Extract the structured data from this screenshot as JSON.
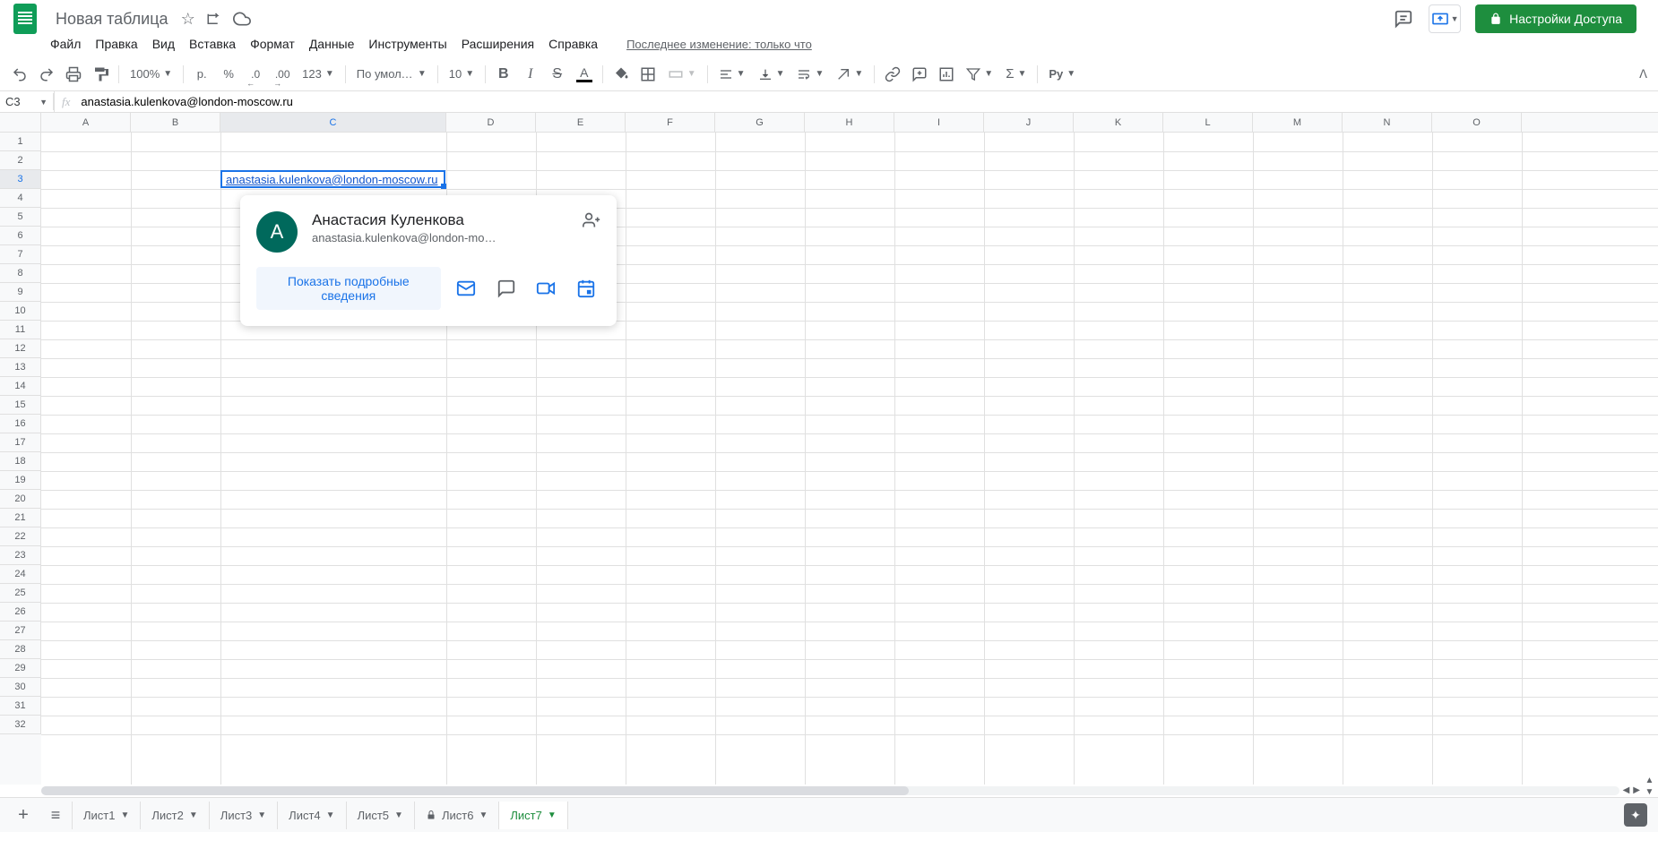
{
  "header": {
    "title": "Новая таблица",
    "last_edit": "Последнее изменение: только что",
    "share_label": "Настройки Доступа"
  },
  "menu": [
    "Файл",
    "Правка",
    "Вид",
    "Вставка",
    "Формат",
    "Данные",
    "Инструменты",
    "Расширения",
    "Справка"
  ],
  "toolbar": {
    "zoom": "100%",
    "currency": "р.",
    "percent": "%",
    "dec_dec": ".0",
    "inc_dec": ".00",
    "format": "123",
    "font": "По умолча...",
    "font_size": "10"
  },
  "formula_bar": {
    "cell_ref": "C3",
    "fx": "fx",
    "value": "anastasia.kulenkova@london-moscow.ru"
  },
  "columns": [
    "A",
    "B",
    "C",
    "D",
    "E",
    "F",
    "G",
    "H",
    "I",
    "J",
    "K",
    "L",
    "M",
    "N",
    "O"
  ],
  "selected_col": "C",
  "rows": [
    1,
    2,
    3,
    4,
    5,
    6,
    7,
    8,
    9,
    10,
    11,
    12,
    13,
    14,
    15,
    16,
    17,
    18,
    19,
    20,
    21,
    22,
    23,
    24,
    25,
    26,
    27,
    28,
    29,
    30,
    31,
    32
  ],
  "selected_row": 3,
  "active_cell_value": "anastasia.kulenkova@london-moscow.ru",
  "contact": {
    "avatar_letter": "А",
    "name": "Анастасия Куленкова",
    "email": "anastasia.kulenkova@london-mosc...",
    "detail_label": "Показать подробные сведения"
  },
  "sheets": [
    {
      "label": "Лист1",
      "active": false,
      "locked": false
    },
    {
      "label": "Лист2",
      "active": false,
      "locked": false
    },
    {
      "label": "Лист3",
      "active": false,
      "locked": false
    },
    {
      "label": "Лист4",
      "active": false,
      "locked": false
    },
    {
      "label": "Лист5",
      "active": false,
      "locked": false
    },
    {
      "label": "Лист6",
      "active": false,
      "locked": true
    },
    {
      "label": "Лист7",
      "active": true,
      "locked": false
    }
  ]
}
